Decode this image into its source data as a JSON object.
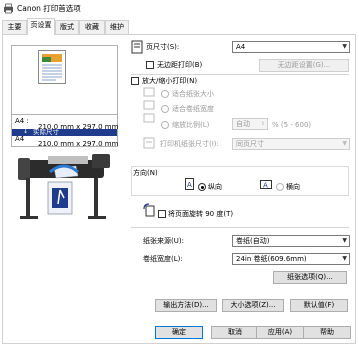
{
  "window": {
    "title": "Canon 打印首选项"
  },
  "tabs": [
    {
      "label": "主要",
      "active": false
    },
    {
      "label": "页设置",
      "active": true
    },
    {
      "label": "版式",
      "active": false
    },
    {
      "label": "收藏",
      "active": false
    },
    {
      "label": "维护",
      "active": false
    }
  ],
  "preview": {
    "input_name": "A4 :",
    "input_size": "210.0 mm x 297.0 mm",
    "actual_size": "实际尺寸",
    "output_name": "A4",
    "output_size": "210.0 mm x 297.0 mm"
  },
  "page_size": {
    "label": "页尺寸(S):",
    "value": "A4"
  },
  "borderless": {
    "label": "无边距打印(B)",
    "checked": false,
    "settings_button": "无边距设置(G)..."
  },
  "scaling": {
    "label": "放大/缩小打印(N)",
    "checked": false,
    "fit_roll": "适合纸张大小",
    "fit_roll_width": "适合卷纸宽度",
    "scale": "缩放比例(L)",
    "scale_value": "自动",
    "scale_range": "% (5 - 600)"
  },
  "output_size": {
    "label": "打印机纸张尺寸(I):",
    "value": "同页尺寸"
  },
  "orientation": {
    "label": "方向(N)",
    "portrait": "纵向",
    "landscape": "横向",
    "selected": "portrait"
  },
  "rotate": {
    "label": "将页面旋转 90 度(T)",
    "checked": false
  },
  "paper_source": {
    "label": "纸张来源(U):",
    "value": "卷纸(自动)"
  },
  "roll_width": {
    "label": "卷纸宽度(L):",
    "value": "24in 卷纸(609.6mm)"
  },
  "buttons": {
    "paper_options": "纸张选项(Q)...",
    "output_method": "输出方法(D)...",
    "size_options": "大小选项(Z)...",
    "defaults": "默认值(F)",
    "ok": "确定",
    "cancel": "取消",
    "apply": "应用(A)",
    "help": "帮助"
  },
  "colors": {
    "accent": "#0078d7",
    "preview_blue": "#1f3c8c"
  }
}
